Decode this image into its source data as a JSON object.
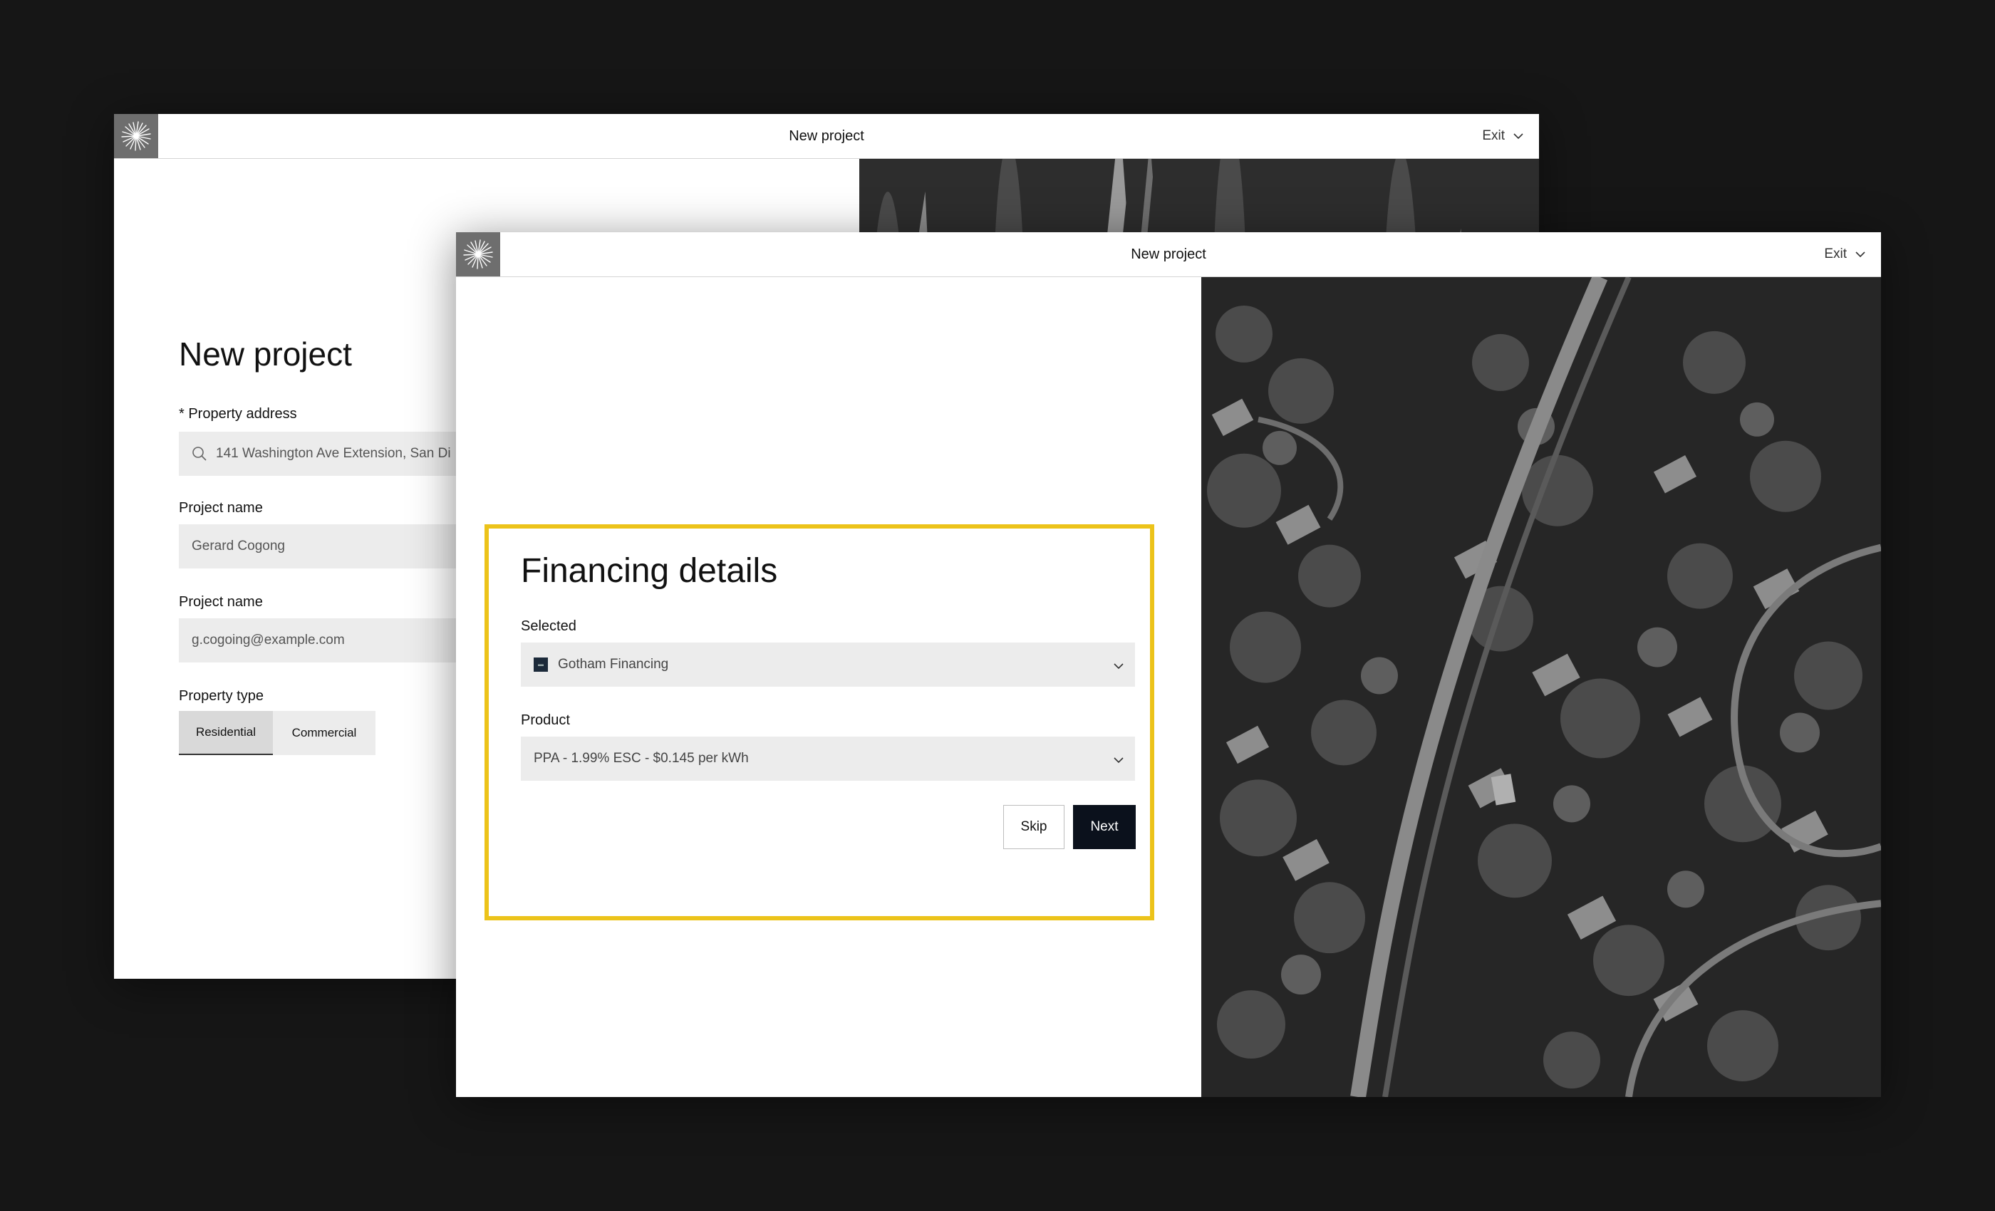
{
  "back_window": {
    "topbar": {
      "title": "New project",
      "exit_label": "Exit"
    },
    "heading": "New project",
    "address": {
      "label": "* Property address",
      "value": "141 Washington Ave Extension, San Di"
    },
    "project_name": {
      "label": "Project name",
      "value": "Gerard Cogong"
    },
    "email_field": {
      "label": "Project name",
      "value": "g.cogoing@example.com"
    },
    "property_type": {
      "label": "Property type",
      "options": [
        "Residential",
        "Commercial"
      ],
      "selected": "Residential"
    }
  },
  "front_window": {
    "topbar": {
      "title": "New project",
      "exit_label": "Exit"
    },
    "heading": "Financing details",
    "selected": {
      "label": "Selected",
      "value": "Gotham Financing"
    },
    "product": {
      "label": "Product",
      "value": "PPA - 1.99% ESC - $0.145 per kWh"
    },
    "buttons": {
      "skip": "Skip",
      "next": "Next"
    }
  },
  "colors": {
    "background": "#161616",
    "highlight": "#ecc31a",
    "primary_button": "#0b111c",
    "field_bg": "#ececec"
  },
  "icons": [
    "sunburst-logo-icon",
    "chevron-down-icon",
    "search-icon",
    "financier-logo-icon"
  ]
}
